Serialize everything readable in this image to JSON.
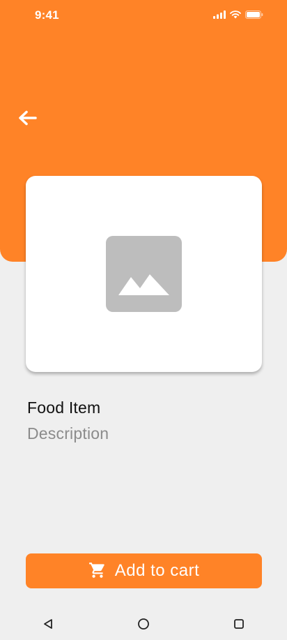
{
  "status_bar": {
    "time": "9:41",
    "icons": [
      "signal-icon",
      "wifi-icon",
      "battery-icon"
    ]
  },
  "header": {
    "back_icon": "arrow-left-icon",
    "background_color": "#ff8327"
  },
  "product": {
    "image_icon": "image-placeholder-icon",
    "title": "Food Item",
    "description": "Description"
  },
  "actions": {
    "add_to_cart_label": "Add to cart",
    "add_to_cart_icon": "cart-icon",
    "button_color": "#ff8327"
  },
  "system_nav": {
    "buttons": [
      "back-triangle-icon",
      "home-circle-icon",
      "recents-square-icon"
    ]
  }
}
